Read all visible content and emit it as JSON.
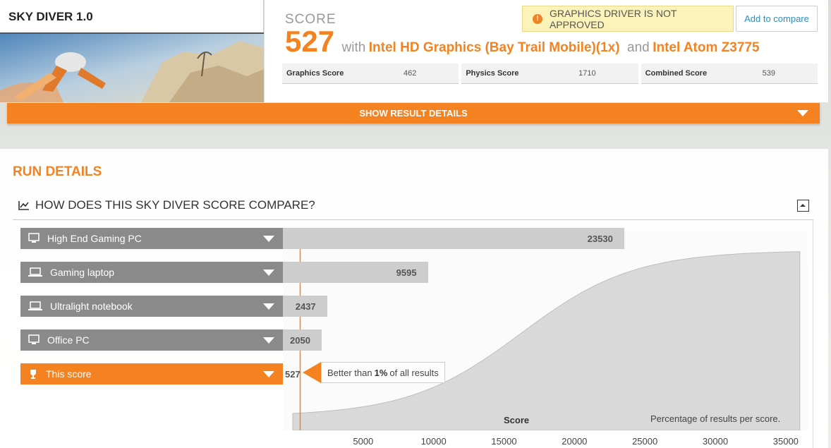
{
  "test": {
    "title": "SKY DIVER 1.0"
  },
  "score": {
    "label": "SCORE",
    "value": "527",
    "with": "with",
    "gpu": "Intel HD Graphics (Bay Trail Mobile)(1x)",
    "and": "and",
    "cpu": "Intel Atom Z3775"
  },
  "warning": {
    "icon": "!",
    "text": "GRAPHICS DRIVER IS NOT APPROVED"
  },
  "add_compare_label": "Add to compare",
  "subscores": [
    {
      "label": "Graphics Score",
      "value": "462"
    },
    {
      "label": "Physics Score",
      "value": "1710"
    },
    {
      "label": "Combined Score",
      "value": "539"
    }
  ],
  "show_details_label": "SHOW RESULT DETAILS",
  "run_details_title": "RUN DETAILS",
  "compare_heading": "HOW DOES THIS SKY DIVER SCORE COMPARE?",
  "comparisons": [
    {
      "label": "High End Gaming PC",
      "value": 23530,
      "display": "23530",
      "icon": "desktop-icon"
    },
    {
      "label": "Gaming laptop",
      "value": 9595,
      "display": "9595",
      "icon": "laptop-icon"
    },
    {
      "label": "Ultralight notebook",
      "value": 2437,
      "display": "2437",
      "icon": "laptop-icon"
    },
    {
      "label": "Office PC",
      "value": 2050,
      "display": "2050",
      "icon": "desktop-icon"
    },
    {
      "label": "This score",
      "value": 527,
      "display": "527",
      "icon": "trophy-icon"
    }
  ],
  "callout": {
    "prefix": "Better than",
    "percent": "1%",
    "suffix": "of all results"
  },
  "chart_data": {
    "type": "area",
    "xlabel": "Score",
    "note": "Percentage of results per score.",
    "xlim": [
      0,
      36000
    ],
    "x_ticks": [
      5000,
      10000,
      15000,
      20000,
      25000,
      30000,
      35000
    ],
    "marker_value": 527
  },
  "colors": {
    "accent": "#f58220",
    "bar_grey": "#cdcdcd",
    "label_grey": "#8a8a8a",
    "warning_bg": "#fbf3ba"
  }
}
